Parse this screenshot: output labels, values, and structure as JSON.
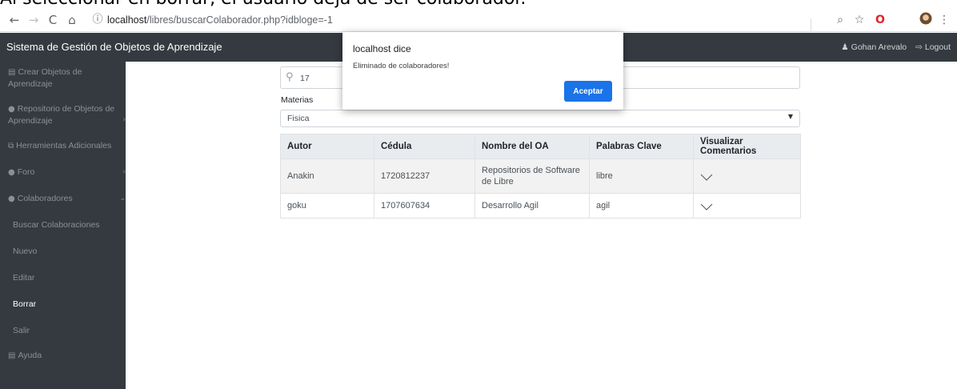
{
  "caption": "Al seleccionar en borrar, el usuario deja de ser colaborador.",
  "browser": {
    "url_host": "localhost",
    "url_path": "/libres/buscarColaborador.php?idbloge=-1"
  },
  "navbar": {
    "brand": "Sistema de Gestión de Objetos de Aprendizaje",
    "user_name": "Gohan Arevalo",
    "logout_label": "Logout"
  },
  "sidebar": {
    "items": [
      {
        "label": "Crear Objetos de",
        "label2": "Aprendizaje"
      },
      {
        "label": "Repositorio de Objetos de",
        "label2": "Aprendizaje"
      },
      {
        "label": "Herramientas Adicionales"
      },
      {
        "label": "Foro"
      },
      {
        "label": "Colaboradores"
      },
      {
        "label": "Buscar Colaboraciones"
      },
      {
        "label": "Nuevo"
      },
      {
        "label": "Editar"
      },
      {
        "label": "Borrar"
      },
      {
        "label": "Salir"
      },
      {
        "label": "Ayuda"
      }
    ]
  },
  "search": {
    "value": "17"
  },
  "filter": {
    "label": "Materias",
    "selected": "Fisica"
  },
  "table": {
    "headers": [
      "Autor",
      "Cédula",
      "Nombre del OA",
      "Palabras Clave",
      "Visualizar Comentarios"
    ],
    "rows": [
      [
        "Anakin",
        "1720812237",
        "Repositorios de Software de Libre",
        "libre"
      ],
      [
        "goku",
        "1707607634",
        "Desarrollo Agil",
        "agil"
      ]
    ]
  },
  "dialog": {
    "title": "localhost dice",
    "message": "Eliminado de colaboradores!",
    "ok_label": "Aceptar"
  }
}
